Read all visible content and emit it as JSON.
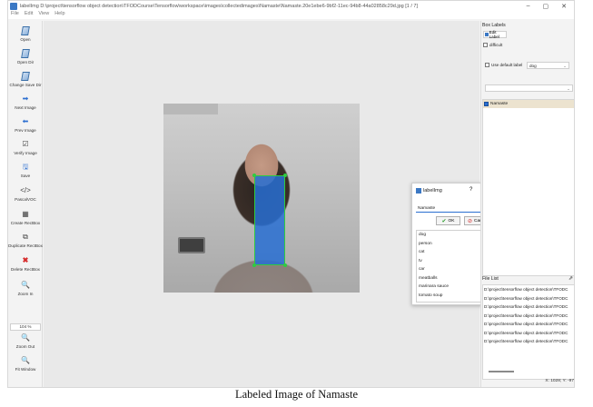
{
  "window": {
    "title": "labelImg D:\\project\\tensorflow object detection\\TFODCourse\\Tensorflow\\workspace\\images\\collectedimages\\Namaste\\Namaste.20e1ebe6-9bf2-11ec-94b8-44a02858c29d.jpg [1 / 7]",
    "minimize": "–",
    "maximize": "▢",
    "close": "✕"
  },
  "menu": [
    "File",
    "Edit",
    "View",
    "Help"
  ],
  "toolbar": {
    "open": "Open",
    "open_dir": "Open Dir",
    "change_save_dir": "Change Save Dir",
    "next_image": "Next Image",
    "prev_image": "Prev Image",
    "verify_image": "Verify Image",
    "save": "Save",
    "format": "PascalVOC",
    "format_icon": "</>",
    "create_rectbox": "Create RectBox",
    "duplicate_rectbox": "Duplicate RectBox",
    "delete_rectbox": "Delete RectBox",
    "zoom_in": "Zoom In",
    "zoom_value": "104 %",
    "zoom_out": "Zoom Out",
    "fit_window": "Fit Window"
  },
  "dialog": {
    "title": "labelImg",
    "help": "?",
    "close": "✕",
    "input_value": "Namaste",
    "ok": "OK",
    "cancel": "Cancel",
    "labels": [
      "dog",
      "person",
      "cat",
      "tv",
      "car",
      "meatballs",
      "marinara sauce",
      "tomato soup"
    ]
  },
  "right_panel": {
    "box_labels_title": "Box Labels",
    "edit_label": "Edit Label",
    "difficult": "difficult",
    "use_default_label": "Use default label",
    "default_label_value": "dog",
    "labels": [
      "Namaste"
    ],
    "file_list_title": "File List",
    "files": [
      "D:\\project\\tensorflow object detection\\TFODC",
      "D:\\project\\tensorflow object detection\\TFODC",
      "D:\\project\\tensorflow object detection\\TFODC",
      "D:\\project\\tensorflow object detection\\TFODC",
      "D:\\project\\tensorflow object detection\\TFODC",
      "D:\\project\\tensorflow object detection\\TFODC",
      "D:\\project\\tensorflow object detection\\TFODC"
    ]
  },
  "status": "X: 1028; Y: -97",
  "caption": "Labeled Image of Namaste"
}
